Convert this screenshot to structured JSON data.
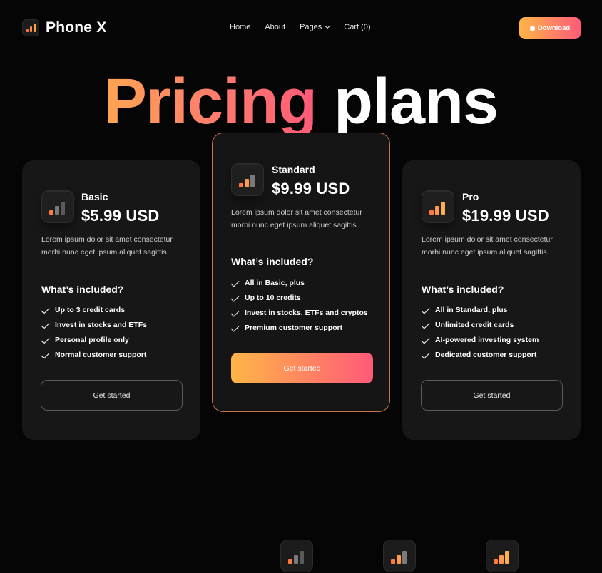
{
  "brand": {
    "name": "Phone X"
  },
  "nav": {
    "items": [
      {
        "label": "Home"
      },
      {
        "label": "About"
      },
      {
        "label": "Pages"
      },
      {
        "label": "Cart (0)"
      }
    ],
    "download_label": "Download"
  },
  "hero": {
    "highlight": "Pricing",
    "rest": "plans"
  },
  "plans": [
    {
      "tier": "Basic",
      "price": "$5.99 USD",
      "description": "Lorem ipsum dolor sit amet consectetur morbi nunc eget ipsum aliquet sagittis.",
      "included_heading": "What’s included?",
      "features": [
        "Up to 3 credit cards",
        "Invest in stocks and ETFs",
        "Personal profile only",
        "Normal customer support"
      ],
      "cta": "Get started",
      "icon": "bar-chart-icon"
    },
    {
      "tier": "Standard",
      "price": "$9.99 USD",
      "description": "Lorem ipsum dolor sit amet consectetur morbi nunc eget ipsum aliquet sagittis.",
      "included_heading": "What’s included?",
      "features": [
        "All in Basic, plus",
        "Up to 10 credits",
        "Invest in stocks, ETFs and cryptos",
        "Premium customer support"
      ],
      "cta": "Get started",
      "icon": "bar-chart-icon"
    },
    {
      "tier": "Pro",
      "price": "$19.99 USD",
      "description": "Lorem ipsum dolor sit amet consectetur morbi nunc eget ipsum aliquet sagittis.",
      "included_heading": "What’s included?",
      "features": [
        "All in Standard, plus",
        "Unlimited credit cards",
        "AI-powered investing system",
        "Dedicated customer support"
      ],
      "cta": "Get started",
      "icon": "bar-chart-icon"
    }
  ],
  "colors": {
    "accent_start": "#ffb547",
    "accent_end": "#ff5a78",
    "background": "#050505",
    "card": "#171717",
    "featured_border": "#c9704e"
  }
}
